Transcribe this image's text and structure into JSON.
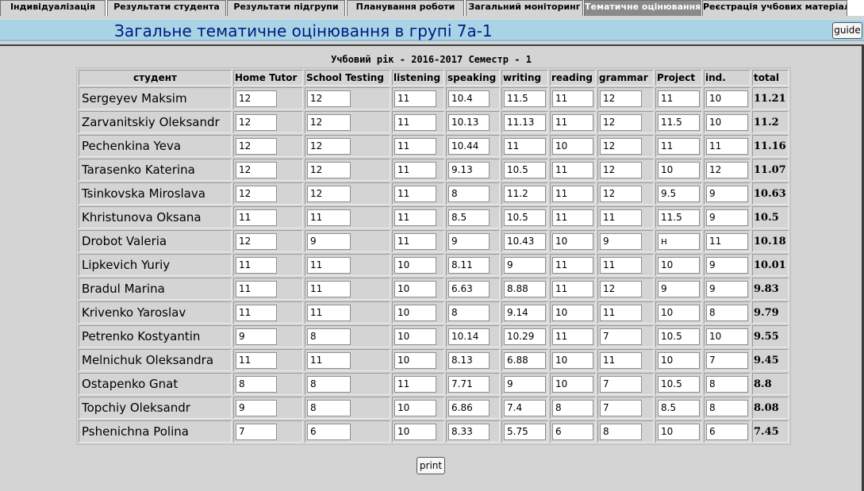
{
  "tabs": [
    {
      "label": "Індивідуалізація",
      "active": false
    },
    {
      "label": "Результати студента",
      "active": false
    },
    {
      "label": "Результати підгрупи",
      "active": false
    },
    {
      "label": "Планування роботи",
      "active": false
    },
    {
      "label": "Загальний моніторинг",
      "active": false
    },
    {
      "label": "Тематичне оцінювання",
      "active": true
    },
    {
      "label": "Реєстрація учбових матеріалів",
      "active": false
    }
  ],
  "header": {
    "title": "Загальне тематичне оцінювання в групі 7а-1",
    "guide_label": "guide"
  },
  "caption": "Учбовий рік - 2016-2017 Семестр - 1",
  "table": {
    "headers": [
      "студент",
      "Home Tutor",
      "School Testing",
      "listening",
      "speaking",
      "writing",
      "reading",
      "grammar",
      "Project",
      "ind.",
      "total"
    ],
    "rows": [
      {
        "name": "Sergeyev Maksim",
        "values": [
          "12",
          "12",
          "11",
          "10.4",
          "11.5",
          "11",
          "12",
          "11",
          "10"
        ],
        "total": "11.21"
      },
      {
        "name": "Zarvanitskiy Oleksandr",
        "values": [
          "12",
          "12",
          "11",
          "10.13",
          "11.13",
          "11",
          "12",
          "11.5",
          "10"
        ],
        "total": "11.2"
      },
      {
        "name": "Pechenkina Yeva",
        "values": [
          "12",
          "12",
          "11",
          "10.44",
          "11",
          "10",
          "12",
          "11",
          "11"
        ],
        "total": "11.16"
      },
      {
        "name": "Tarasenko Katerina",
        "values": [
          "12",
          "12",
          "11",
          "9.13",
          "10.5",
          "11",
          "12",
          "10",
          "12"
        ],
        "total": "11.07"
      },
      {
        "name": "Tsinkovska Miroslava",
        "values": [
          "12",
          "12",
          "11",
          "8",
          "11.2",
          "11",
          "12",
          "9.5",
          "9"
        ],
        "total": "10.63"
      },
      {
        "name": "Khristunova Oksana",
        "values": [
          "11",
          "11",
          "11",
          "8.5",
          "10.5",
          "11",
          "11",
          "11.5",
          "9"
        ],
        "total": "10.5"
      },
      {
        "name": "Drobot Valeria",
        "values": [
          "12",
          "9",
          "11",
          "9",
          "10.43",
          "10",
          "9",
          "н",
          "11"
        ],
        "total": "10.18"
      },
      {
        "name": "Lipkevich Yuriy",
        "values": [
          "11",
          "11",
          "10",
          "8.11",
          "9",
          "11",
          "11",
          "10",
          "9"
        ],
        "total": "10.01"
      },
      {
        "name": "Bradul Marina",
        "values": [
          "11",
          "11",
          "10",
          "6.63",
          "8.88",
          "11",
          "12",
          "9",
          "9"
        ],
        "total": "9.83"
      },
      {
        "name": "Krivenko Yaroslav",
        "values": [
          "11",
          "11",
          "10",
          "8",
          "9.14",
          "10",
          "11",
          "10",
          "8"
        ],
        "total": "9.79"
      },
      {
        "name": "Petrenko Kostyantin",
        "values": [
          "9",
          "8",
          "10",
          "10.14",
          "10.29",
          "11",
          "7",
          "10.5",
          "10"
        ],
        "total": "9.55"
      },
      {
        "name": "Melnichuk Oleksandra",
        "values": [
          "11",
          "11",
          "10",
          "8.13",
          "6.88",
          "10",
          "11",
          "10",
          "7"
        ],
        "total": "9.45"
      },
      {
        "name": "Ostapenko Gnat",
        "values": [
          "8",
          "8",
          "11",
          "7.71",
          "9",
          "10",
          "7",
          "10.5",
          "8"
        ],
        "total": "8.8"
      },
      {
        "name": "Topchiy Oleksandr",
        "values": [
          "9",
          "8",
          "10",
          "6.86",
          "7.4",
          "8",
          "7",
          "8.5",
          "8"
        ],
        "total": "8.08"
      },
      {
        "name": "Pshenichna Polina",
        "values": [
          "7",
          "6",
          "10",
          "8.33",
          "5.75",
          "6",
          "8",
          "10",
          "6"
        ],
        "total": "7.45"
      }
    ]
  },
  "print_label": "print"
}
